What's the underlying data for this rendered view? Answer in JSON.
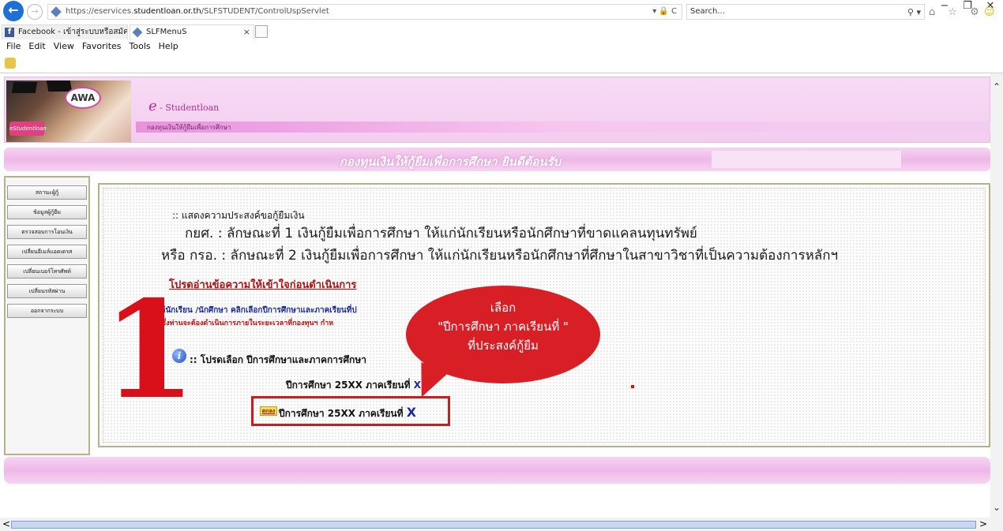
{
  "window": {
    "minimize": "−",
    "restore": "❐",
    "close": "✕"
  },
  "browser": {
    "back": "←",
    "forward": "→",
    "url_prefix": "https://eservices.",
    "url_domain": "studentloan.or.th",
    "url_path": "/SLFSTUDENT/ControlUspServlet",
    "url_right": "▾ 🔒 C",
    "search_placeholder": "Search...",
    "search_icon": "⚲ ▾",
    "toolbar_icons": "⌂ ☆ ⚙",
    "smiley": "☺"
  },
  "tabs": [
    {
      "label": "Facebook - เข้าสู่ระบบหรือสมัครใช้...",
      "icon": "f"
    },
    {
      "label": "SLFMenuS",
      "close": "×"
    }
  ],
  "menubar": [
    "File",
    "Edit",
    "View",
    "Favorites",
    "Tools",
    "Help"
  ],
  "banner": {
    "logo_text": "AWA",
    "photo_tag": "eStudentloan",
    "brand_e": "e",
    "brand_rest": " - Studentloan",
    "tagline": "กองทุนเงินให้กู้ยืมเพื่อการศึกษา"
  },
  "welcome": "กองทุนเงินให้กู้ยืมเพื่อการศึกษา ยินดีต้อนรับ",
  "left_menu": [
    "สถานะผู้กู้",
    "ข้อมูลผู้กู้ยืม",
    "ตรวจสอบการโอนเงิน",
    "เปลี่ยนอีเมล์แอดเดรส",
    "เปลี่ยนเบอร์โทรศัพท์",
    "เปลี่ยนรหัสผ่าน",
    "ออกจากระบบ"
  ],
  "content": {
    "intro": ":: แสดงความประสงค์ขอกู้ยืมเงิน",
    "line_a": "กยศ. : ลักษณะที่ 1 เงินกู้ยืมเพื่อการศึกษา ให้แก่นักเรียนหรือนักศึกษาที่ขาดแคลนทุนทรัพย์",
    "line_b": "หรือ กรอ. : ลักษณะที่ 2 เงินกู้ยืมเพื่อการศึกษา ให้แก่นักเรียนหรือนักศึกษาที่ศึกษาในสาขาวิชาที่เป็นความต้องการหลักฯ",
    "notice": "โปรดอ่านข้อความให้เข้าใจก่อนดำเนินการ",
    "instr_blue": "ให้นักเรียน /นักศึกษา คลิกเลือกปีการศึกษาและภาคเรียนที่ป",
    "instr_red": "ซึ่งท่านจะต้องดำเนินการภายในระยะเวลาที่กองทุนฯ กำห",
    "choose": ":: โปรดเลือก ปีการศึกษาและภาคการศึกษา",
    "year1_text": "ปีการศึกษา 25XX ภาคเรียนที่ ",
    "year1_x": "X",
    "ok_label": "ตกลง",
    "year2_text": "ปีการศึกษา 25XX ภาคเรียนที่ ",
    "year2_x": "X"
  },
  "callout": {
    "line1": "เลือก",
    "line2": "\"ปีการศึกษา    ภาคเรียนที่  \"",
    "line3": "ที่ประสงค์กู้ยืม"
  },
  "step_number": "1",
  "scroll": {
    "up": "⌃",
    "down": "⌄",
    "left": "<",
    "right": ">"
  }
}
